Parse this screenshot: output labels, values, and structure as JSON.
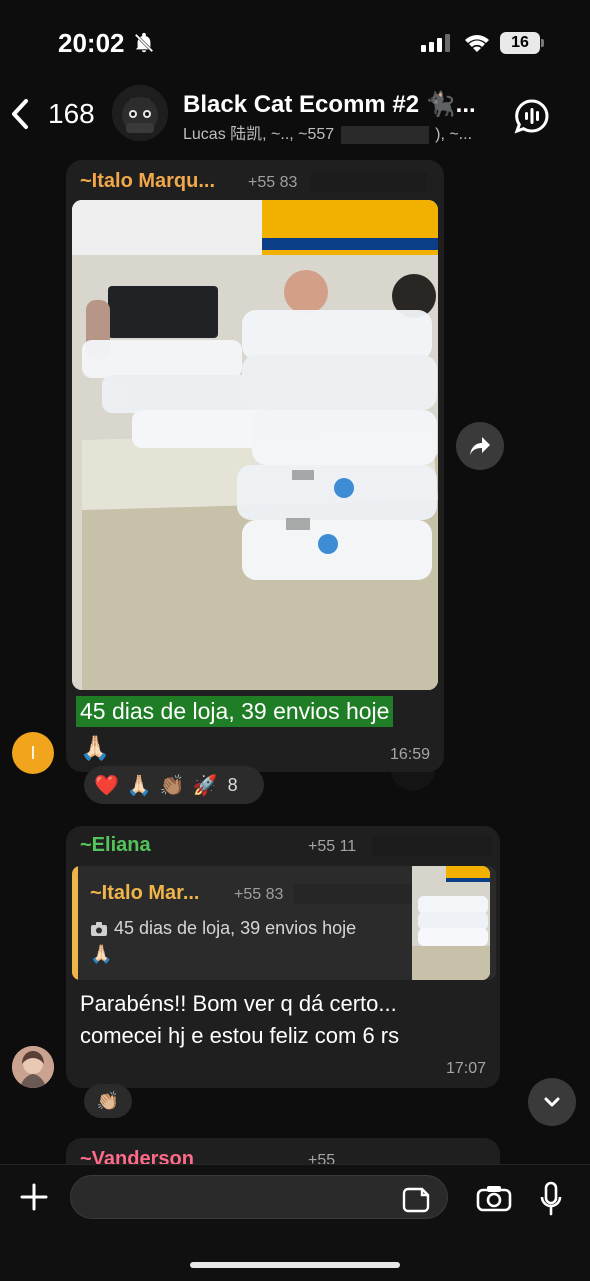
{
  "status": {
    "time": "20:02",
    "battery": "16"
  },
  "header": {
    "back_count": "168",
    "title": "Black Cat Ecomm #2 🐈‍⬛...",
    "subtitle": "Lucas 陆凯, ~.., ~557",
    "subtitle_suffix": "), ~..."
  },
  "messages": [
    {
      "sender": "~Italo Marqu...",
      "phone": "+55 83",
      "text": "45 dias de loja, 39 envios hoje",
      "emoji": "🙏🏻",
      "time": "16:59",
      "reactions": [
        "❤️",
        "🙏🏻",
        "👏🏽",
        "🚀"
      ],
      "reaction_count": "8",
      "avatar_initial": "I"
    },
    {
      "sender": "~Eliana",
      "phone": "+55 11",
      "quote": {
        "sender": "~Italo Mar...",
        "phone": "+55 83",
        "text": "45 dias de loja, 39 envios hoje",
        "emoji": "🙏🏻"
      },
      "text_line1": "Parabéns!! Bom ver q dá certo...",
      "text_line2": "comecei hj e estou feliz com 6 rs",
      "time": "17:07",
      "reaction": "👏🏼"
    },
    {
      "sender": "~Vanderson",
      "phone": "+55"
    }
  ],
  "icons": {
    "bell_off": "bell-off-icon",
    "signal": "signal-icon",
    "wifi": "wifi-icon",
    "back": "chevron-left-icon",
    "voice_chat": "voice-chat-icon",
    "forward": "forward-icon",
    "scroll_down": "chevron-down-icon",
    "plus": "plus-icon",
    "sticker": "sticker-icon",
    "camera": "camera-icon",
    "mic": "mic-icon",
    "photo_camera_small": "camera-small-icon"
  }
}
